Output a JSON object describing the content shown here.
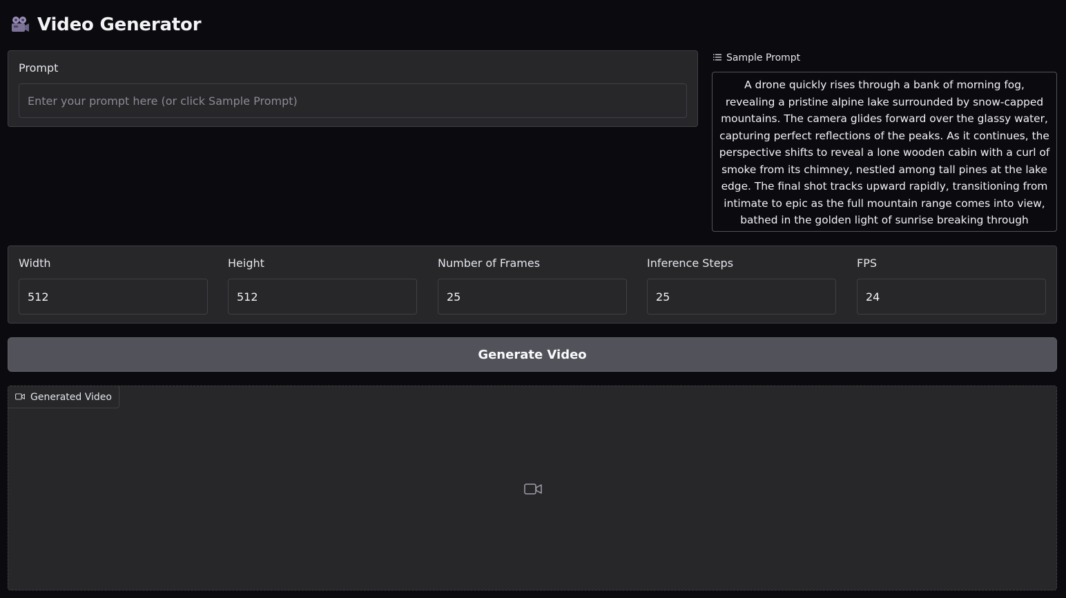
{
  "app": {
    "title": "Video Generator",
    "title_icon": "movie-camera-icon"
  },
  "prompt": {
    "label": "Prompt",
    "placeholder": "Enter your prompt here (or click Sample Prompt)",
    "value": ""
  },
  "sample": {
    "label": "Sample Prompt",
    "icon": "list-icon",
    "text": "A drone quickly rises through a bank of morning fog, revealing a pristine alpine lake surrounded by snow-capped mountains. The camera glides forward over the glassy water, capturing perfect reflections of the peaks. As it continues, the perspective shifts to reveal a lone wooden cabin with a curl of smoke from its chimney, nestled among tall pines at the lake edge. The final shot tracks upward rapidly, transitioning from intimate to epic as the full mountain range comes into view, bathed in the golden light of sunrise breaking through scattered clouds."
  },
  "settings": {
    "width": {
      "label": "Width",
      "value": "512"
    },
    "height": {
      "label": "Height",
      "value": "512"
    },
    "frames": {
      "label": "Number of Frames",
      "value": "25"
    },
    "steps": {
      "label": "Inference Steps",
      "value": "25"
    },
    "fps": {
      "label": "FPS",
      "value": "24"
    }
  },
  "generate": {
    "label": "Generate Video"
  },
  "output": {
    "label": "Generated Video",
    "icon": "video-camera-icon",
    "placeholder_icon": "video-camera-icon"
  },
  "colors": {
    "background": "#0b0b0f",
    "panel": "#27272a",
    "border": "#3f3f46",
    "button": "#52525b",
    "text": "#e5e7eb"
  }
}
